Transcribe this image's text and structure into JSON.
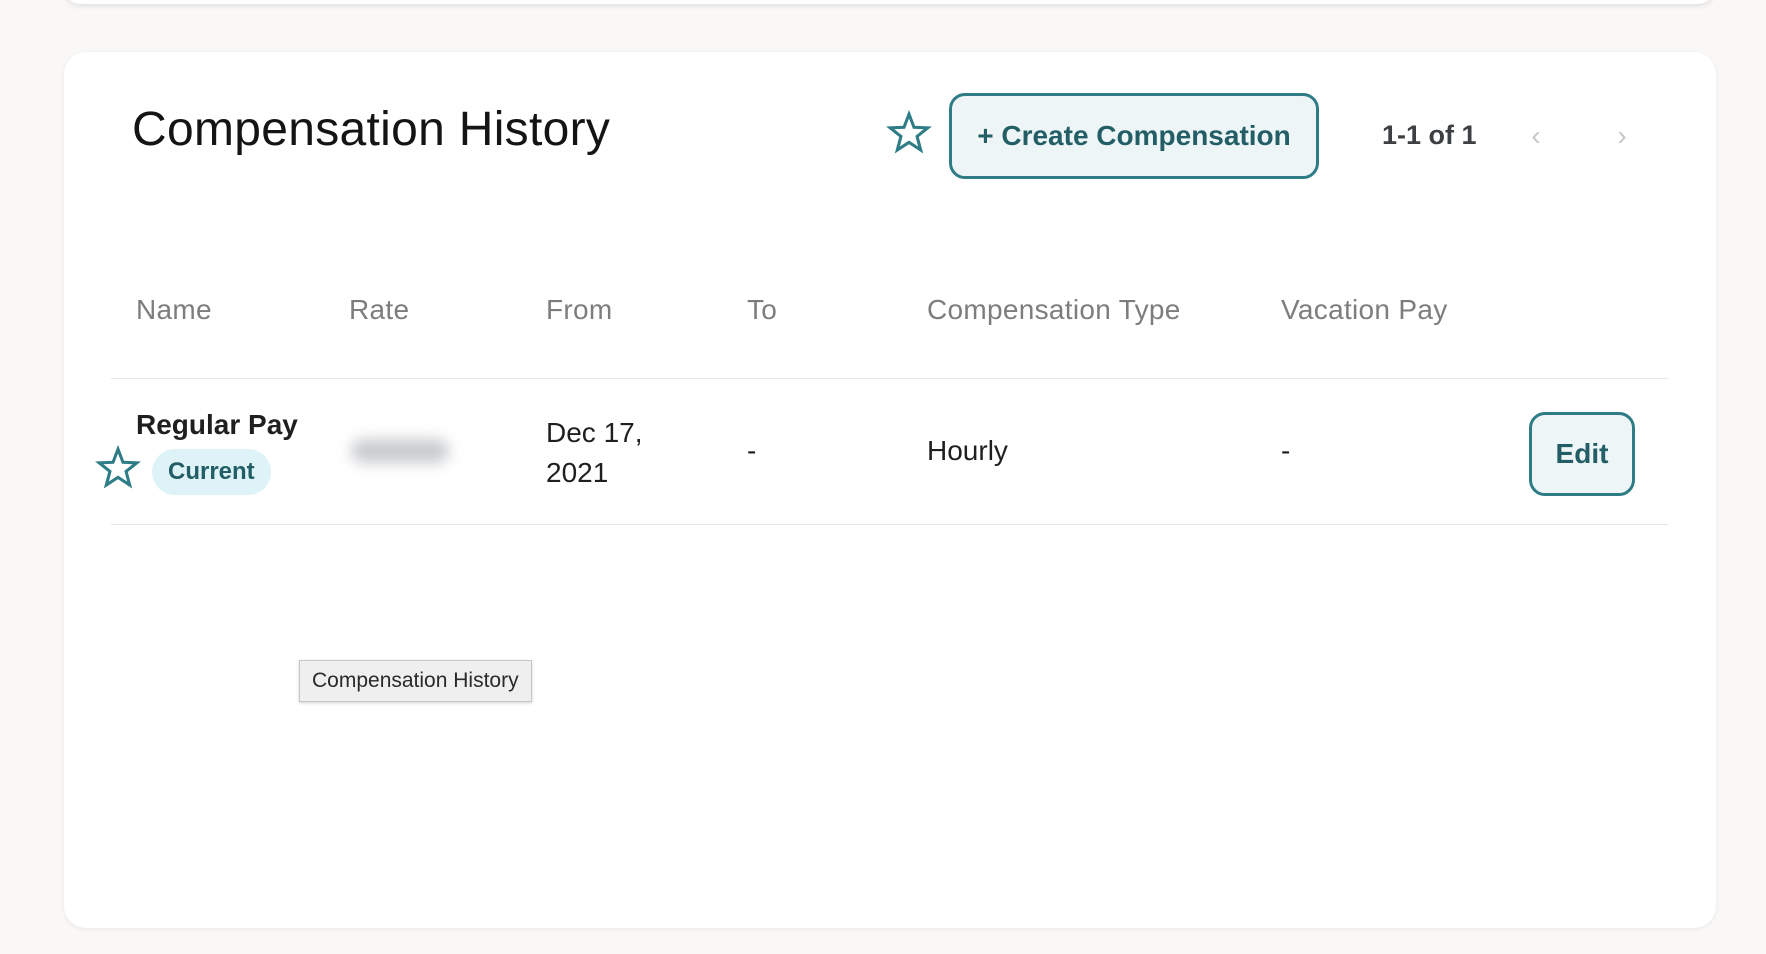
{
  "header": {
    "title": "Compensation History",
    "create_button_label": "+ Create Compensation",
    "pagination_range": "1-1 of 1",
    "prev_glyph": "‹",
    "next_glyph": "›"
  },
  "table": {
    "columns": [
      "Name",
      "Rate",
      "From",
      "To",
      "Compensation Type",
      "Vacation Pay"
    ],
    "rows": [
      {
        "name": "Regular Pay",
        "badge": "Current",
        "rate": "",
        "from": "Dec 17, 2021",
        "to": "-",
        "compensation_type": "Hourly",
        "vacation_pay": "-",
        "action_label": "Edit"
      }
    ]
  },
  "tooltip": "Compensation History",
  "icons": {
    "header_star": "star-outline-icon",
    "row_star": "star-outline-icon",
    "prev": "chevron-left-icon",
    "next": "chevron-right-icon"
  },
  "colors": {
    "accent": "#2e7c86",
    "accent_text": "#235e66",
    "button_bg": "#eef5f7",
    "badge_bg": "#def3f8"
  }
}
